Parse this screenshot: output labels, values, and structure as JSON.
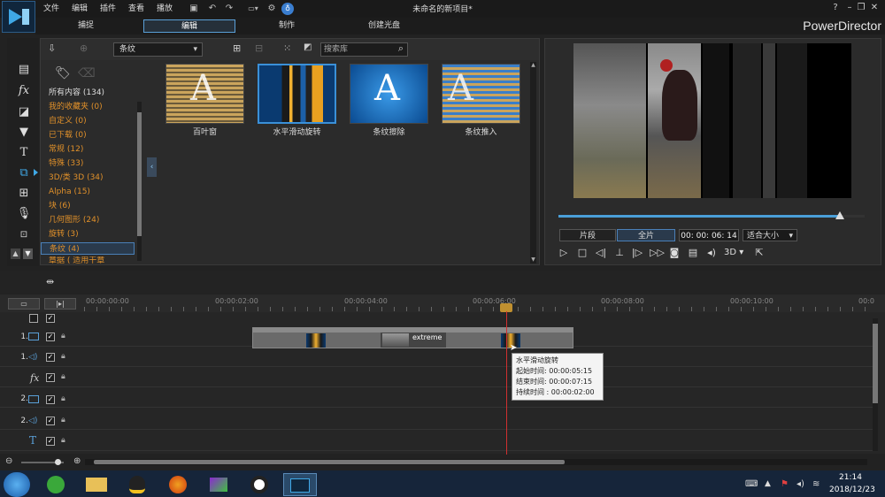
{
  "app": {
    "window_title": "未命名的新项目*",
    "brand": "PowerDirector"
  },
  "menu": [
    "文件",
    "编辑",
    "插件",
    "查看",
    "播放"
  ],
  "mode_tabs": [
    "捕捉",
    "编辑",
    "制作",
    "创建光盘"
  ],
  "library": {
    "dropdown_value": "条纹",
    "search_placeholder": "搜索库",
    "categories": [
      "所有内容 (134)",
      "我的收藏夹 (0)",
      "自定义 (0)",
      "已下载 (0)",
      "常规 (12)",
      "特殊 (33)",
      "3D/类 3D (34)",
      "Alpha (15)",
      "块 (6)",
      "几何图形 (24)",
      "旋转 (3)",
      "条纹 (4)",
      "章据 ( 适用干章"
    ],
    "transitions": [
      "百叶窗",
      "水平滑动旋转",
      "条纹擦除",
      "条纹推入"
    ],
    "thumb_letter": "A"
  },
  "preview": {
    "clip_button": "片段",
    "movie_button": "全片",
    "timecode": "00: 00: 06: 14",
    "fit_label": "适合大小",
    "mode_3d": "3D",
    "progress_fraction": 0.92
  },
  "timeline": {
    "ruler_labels": [
      "00:00:00:00",
      "00:00:02:00",
      "00:00:04:00",
      "00:00:06:00",
      "00:00:08:00",
      "00:00:10:00",
      "00:0"
    ],
    "track_numbers": [
      "1.",
      "1.",
      "",
      "2.",
      "2.",
      ""
    ],
    "clip_label": "extreme",
    "tooltip": {
      "title": "水平滑动旋转",
      "start": "起始时间: 00:00:05:15",
      "end": "结束时间: 00:00:07:15",
      "duration": "持续时间 : 00:00:02:00"
    }
  },
  "taskbar": {
    "time": "21:14",
    "date": "2018/12/23"
  },
  "colors": {
    "accent": "#4a9fd8",
    "category_text": "#e0902a",
    "playhead": "#d03030"
  }
}
